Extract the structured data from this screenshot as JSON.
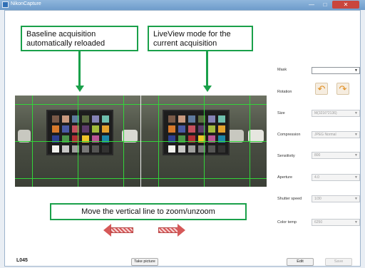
{
  "window": {
    "title": "NikonCapture",
    "min_glyph": "—",
    "max_glyph": "□",
    "close_glyph": "✕"
  },
  "annotations": {
    "left": "Baseline acquisition automatically reloaded",
    "right": "LiveView mode for the current acquisition",
    "bottom": "Move the vertical line to zoom/unzoom"
  },
  "settings": {
    "mask": {
      "label": "Mask",
      "value": ""
    },
    "rotation": {
      "label": "Rotation",
      "left_icon": "rotate-left-icon",
      "right_icon": "rotate-right-icon"
    },
    "size": {
      "label": "Size",
      "value": "M(3216*2136)"
    },
    "compression": {
      "label": "Compression",
      "value": "JPEG Normal"
    },
    "sensitivity": {
      "label": "Sensitivity",
      "value": "800"
    },
    "aperture": {
      "label": "Aperture",
      "value": "4.0"
    },
    "shutter_speed": {
      "label": "Shutter speed",
      "value": "1/30"
    },
    "color_temp": {
      "label": "Color temp",
      "value": "6250"
    }
  },
  "footer": {
    "lot": "L045",
    "take_picture": "Take picture",
    "edit": "Edit",
    "save": "Save"
  },
  "colors": {
    "annotation_green": "#1aa04a",
    "grid_green": "#33d43a",
    "rotate_orange": "#e08b1a",
    "drag_arrow_red": "#d65858"
  }
}
